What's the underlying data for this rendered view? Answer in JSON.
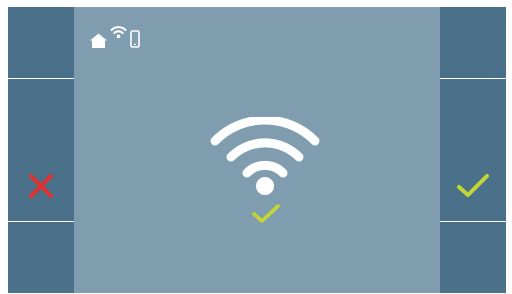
{
  "colors": {
    "screen_bg": "#7f9dae",
    "side_button_bg": "#4a7189",
    "cancel": "#e0312f",
    "confirm": "#c4d634",
    "icon": "#ffffff"
  },
  "status_bar": {
    "icons": [
      "home-icon",
      "wifi-small-icon",
      "phone-icon"
    ]
  },
  "main": {
    "icons": [
      "wifi-large-icon",
      "checkmark-icon"
    ],
    "wifi_connected": true
  },
  "left_panel": {
    "buttons": [
      "",
      "",
      "cancel-x-icon",
      ""
    ]
  },
  "right_panel": {
    "buttons": [
      "",
      "",
      "confirm-check-icon",
      ""
    ]
  }
}
